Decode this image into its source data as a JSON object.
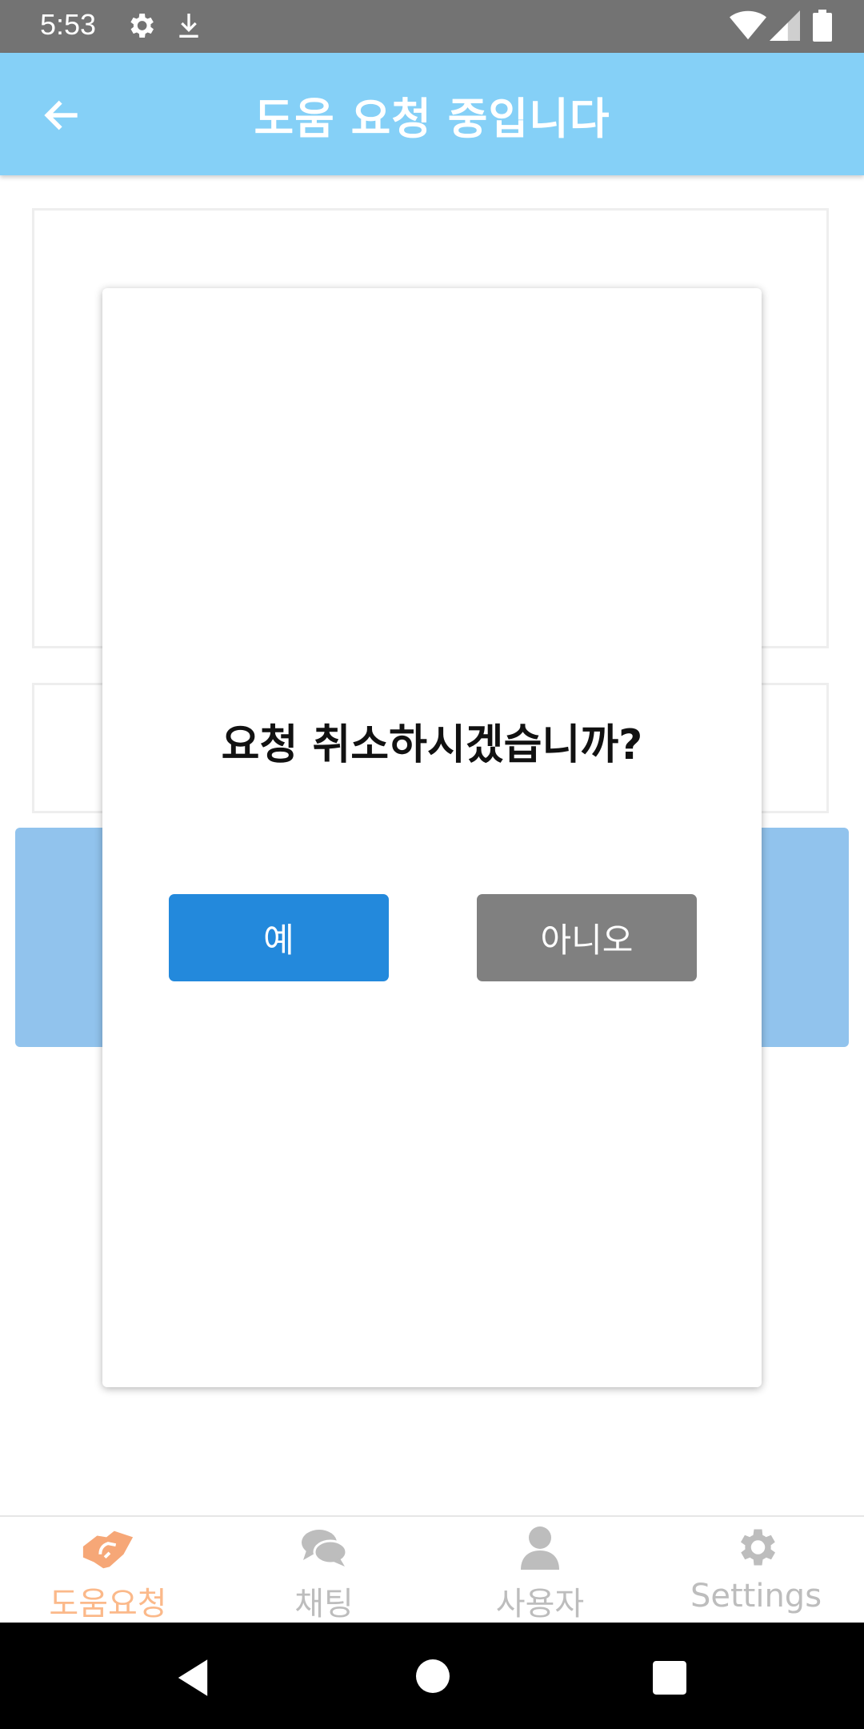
{
  "status_bar": {
    "time": "5:53"
  },
  "app_bar": {
    "title": "도움 요청 중입니다"
  },
  "dialog": {
    "message": "요청 취소하시겠습니까?",
    "yes_label": "예",
    "no_label": "아니오"
  },
  "bottom_nav": {
    "items": [
      {
        "label": "도움요청",
        "icon": "handshake-icon",
        "active": true
      },
      {
        "label": "채팅",
        "icon": "chat-bubbles-icon",
        "active": false
      },
      {
        "label": "사용자",
        "icon": "user-icon",
        "active": false
      },
      {
        "label": "Settings",
        "icon": "gear-icon",
        "active": false
      }
    ]
  },
  "colors": {
    "app_bar": "#85d0f7",
    "primary_button": "#2389dc",
    "secondary_button": "#808080",
    "active_tab": "#fbb98a",
    "inactive_tab": "#bdbdbd"
  }
}
